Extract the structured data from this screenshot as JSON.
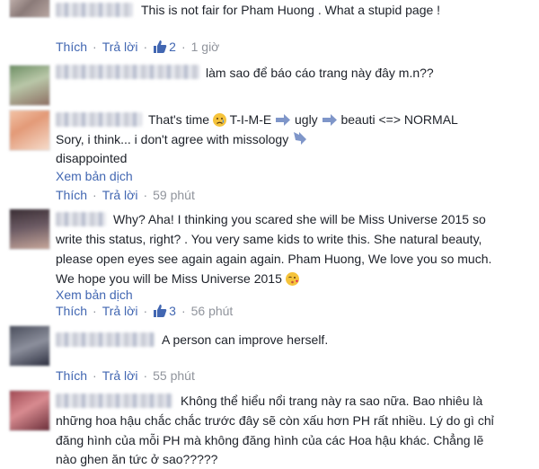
{
  "labels": {
    "like": "Thích",
    "reply": "Trả lời",
    "translate": "Xem bản dịch",
    "sep": "·"
  },
  "comments": [
    {
      "text": "This is not fair for Pham Huong . What a stupid page !",
      "likes": "2",
      "time": "1 giờ"
    },
    {
      "text": "làm sao để báo cáo trang này đây m.n??"
    },
    {
      "part1": "That's time",
      "part2": "T-I-M-E",
      "part3": "ugly",
      "part4": "beauti <=> NORMAL",
      "line2": "Sory, i think... i don't agree with missology",
      "line3": "disappointed",
      "time": "59 phút"
    },
    {
      "line1": "Why? Aha! I thinking you scared she will be Miss Universe 2015 so",
      "line2": "write this status, right? . You very same kids to write this. She natural beauty,",
      "line3": "please open eyes see again again again. Pham Huong, We love you so much.",
      "line4": "We hope you will be Miss Universe 2015",
      "likes": "3",
      "time": "56 phút"
    },
    {
      "text": "A person can improve herself.",
      "time": "55 phút"
    },
    {
      "line1": "Không thể hiểu nổi trang này ra sao nữa. Bao nhiêu là",
      "line2": "những hoa hậu chắc chắc trước đây sẽ còn xấu hơn PH rất nhiều. Lý do gì chỉ",
      "line3": "đăng hình của mỗi PH mà không đăng hình của các Hoa hậu khác. Chẳng lẽ",
      "line4": "nào ghen ăn tức ở sao?????"
    }
  ],
  "colors": {
    "link": "#4267b2",
    "meta": "#90949c",
    "text": "#1d2129",
    "emoji": "#f5c33b",
    "arrow": "#7f96c9"
  }
}
